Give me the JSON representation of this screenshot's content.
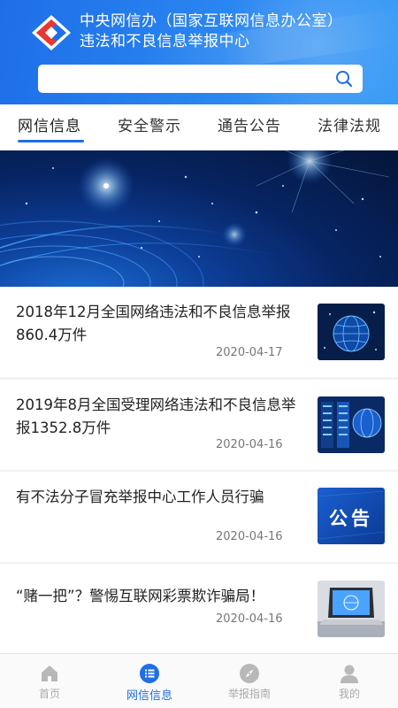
{
  "header": {
    "org_name": "中央网信办（国家互联网信息办公室）",
    "org_sub": "违法和不良信息举报中心"
  },
  "search": {
    "placeholder": ""
  },
  "tabs": [
    {
      "label": "网信信息",
      "active": true
    },
    {
      "label": "安全警示",
      "active": false
    },
    {
      "label": "通告公告",
      "active": false
    },
    {
      "label": "法律法规",
      "active": false
    }
  ],
  "news": [
    {
      "title": "2018年12月全国网络违法和不良信息举报860.4万件",
      "date": "2020-04-17",
      "thumb": "globe-network"
    },
    {
      "title": "2019年8月全国受理网络违法和不良信息举报1352.8万件",
      "date": "2020-04-16",
      "thumb": "server-room"
    },
    {
      "title": "有不法分子冒充举报中心工作人员行骗",
      "date": "2020-04-16",
      "thumb": "announcement",
      "thumb_text": "公告"
    },
    {
      "title": "“赌一把”？警惕互联网彩票欺诈骗局！",
      "date": "2020-04-16",
      "thumb": "laptop"
    }
  ],
  "bottom_nav": [
    {
      "label": "首页",
      "icon": "home-icon",
      "active": false
    },
    {
      "label": "网信信息",
      "icon": "list-icon",
      "active": true
    },
    {
      "label": "举报指南",
      "icon": "compass-icon",
      "active": false
    },
    {
      "label": "我的",
      "icon": "user-icon",
      "active": false
    }
  ],
  "colors": {
    "brand_blue": "#1e6ee8",
    "logo_red": "#e8382f",
    "nav_inactive": "#aaaaaa"
  }
}
